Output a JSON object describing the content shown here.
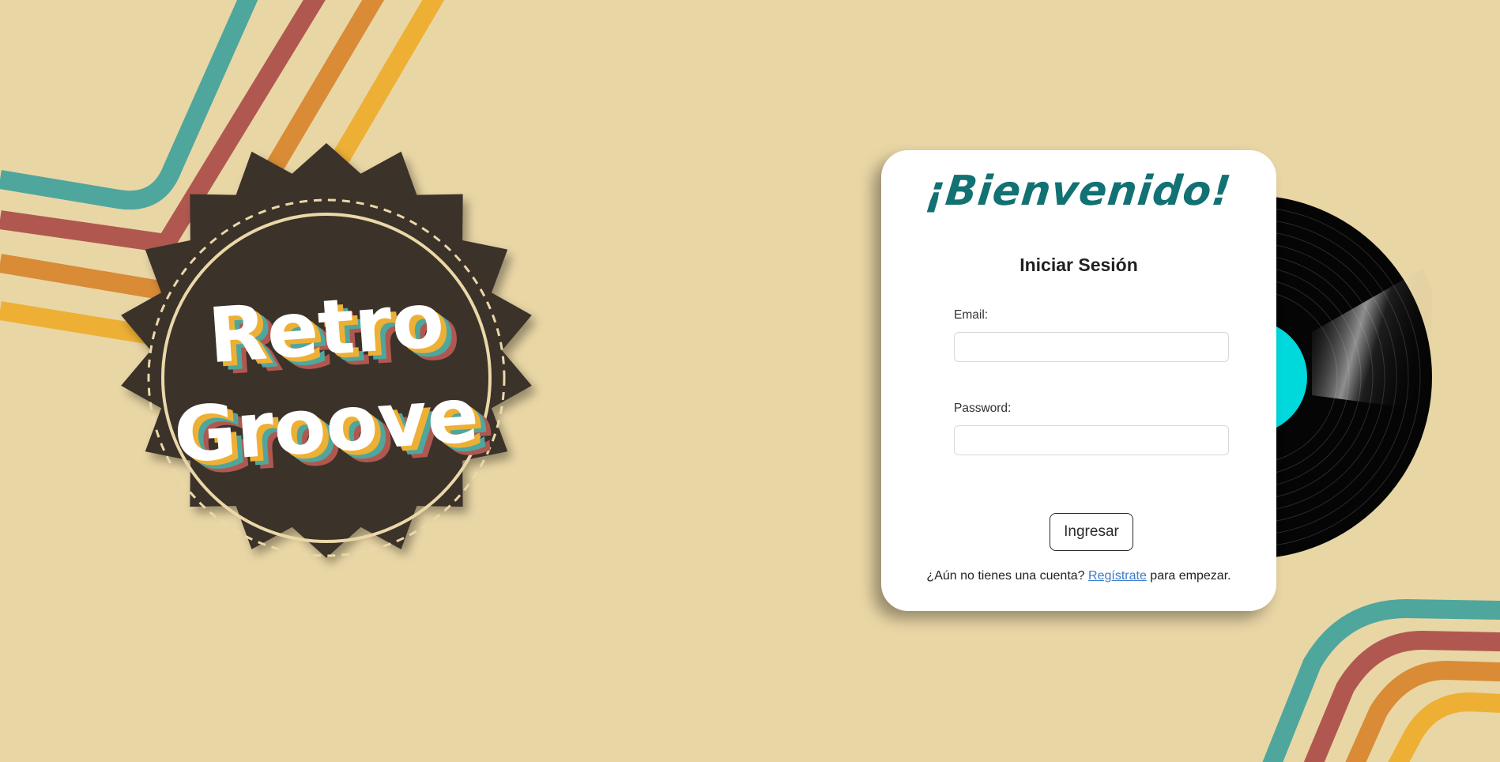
{
  "logo": {
    "line1": "Retro",
    "line2": "Groove"
  },
  "login": {
    "welcome": "¡Bienvenido!",
    "subtitle": "Iniciar Sesión",
    "email_label": "Email:",
    "email_value": "",
    "password_label": "Password:",
    "password_value": "",
    "submit_label": "Ingresar",
    "footer_before": "¿Aún no tienes una cuenta?",
    "register_link": "Regístrate",
    "footer_after": "para empezar."
  },
  "colors": {
    "background": "#E9D6A5",
    "teal": "#4FA69D",
    "red": "#B05850",
    "orange": "#D98B36",
    "yellow": "#EDB035",
    "badge": "#3A302A",
    "title": "#127173",
    "vinyl_label": "#00D9DC"
  }
}
